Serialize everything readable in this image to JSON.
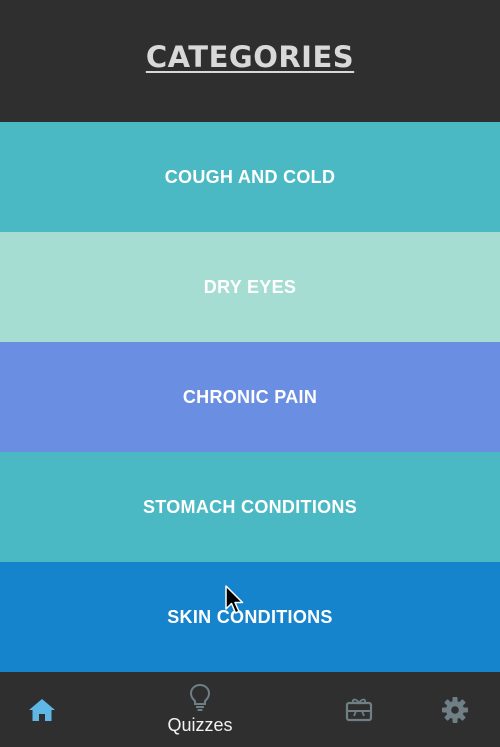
{
  "header": {
    "title": "CATEGORIES"
  },
  "categories": [
    {
      "label": "COUGH AND COLD",
      "color": "#4bb9c3"
    },
    {
      "label": "DRY EYES",
      "color": "#a6ddd3"
    },
    {
      "label": "CHRONIC PAIN",
      "color": "#6a8ee2"
    },
    {
      "label": "STOMACH CONDITIONS",
      "color": "#4bb9c3"
    },
    {
      "label": "SKIN CONDITIONS",
      "color": "#1584cd"
    }
  ],
  "bottom_nav": {
    "items": [
      {
        "icon": "home-icon",
        "label": "",
        "active": true,
        "color": "#5fb7e6"
      },
      {
        "icon": "lightbulb-icon",
        "label": "Quizzes",
        "active": false,
        "color": "#6e7f86"
      },
      {
        "icon": "gift-card-icon",
        "label": "",
        "active": false,
        "color": "#6e7f86"
      },
      {
        "icon": "gear-icon",
        "label": "",
        "active": false,
        "color": "#6e7f86"
      }
    ]
  },
  "colors": {
    "background": "#2f2f2f",
    "header_text": "#d9d9d9"
  }
}
